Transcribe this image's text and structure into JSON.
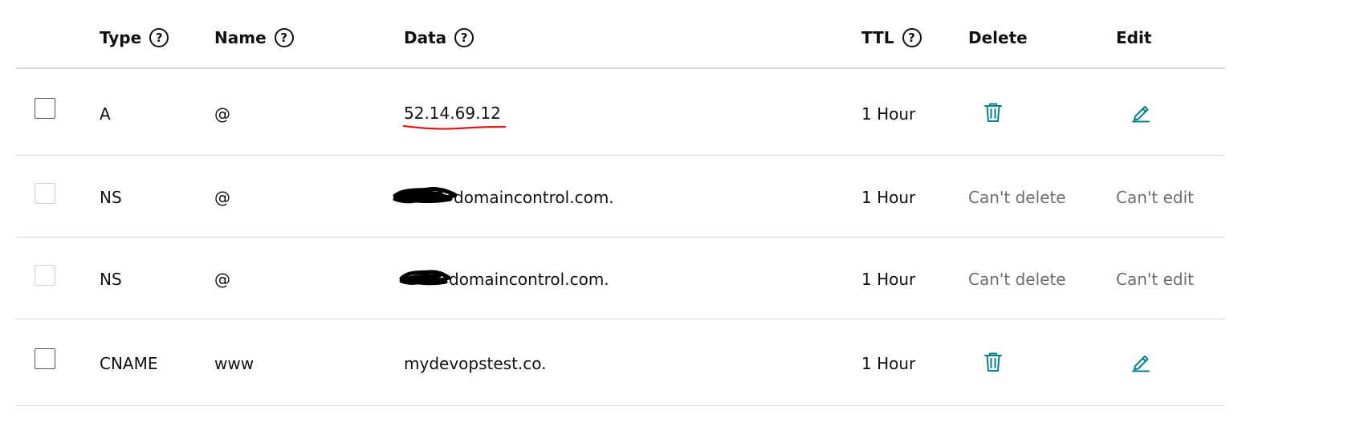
{
  "headers": {
    "type": "Type",
    "name": "Name",
    "data": "Data",
    "ttl": "TTL",
    "delete": "Delete",
    "edit": "Edit"
  },
  "records": [
    {
      "type": "A",
      "name": "@",
      "data": "52.14.69.12",
      "ttl": "1 Hour",
      "delete": null,
      "edit": null
    },
    {
      "type": "NS",
      "name": "@",
      "data": "domaincontrol.com.",
      "ttl": "1 Hour",
      "delete": "Can't delete",
      "edit": "Can't edit"
    },
    {
      "type": "NS",
      "name": "@",
      "data": "domaincontrol.com.",
      "ttl": "1 Hour",
      "delete": "Can't delete",
      "edit": "Can't edit"
    },
    {
      "type": "CNAME",
      "name": "www",
      "data": "mydevopstest.co.",
      "ttl": "1 Hour",
      "delete": null,
      "edit": null
    }
  ],
  "icons": {
    "help": "question-circle-icon",
    "delete": "trash-icon",
    "edit": "pencil-icon"
  },
  "colors": {
    "action_icon": "#00838c",
    "disabled_text": "#6e6e6e",
    "annotation_underline": "#e01818",
    "redaction": "#000000"
  }
}
